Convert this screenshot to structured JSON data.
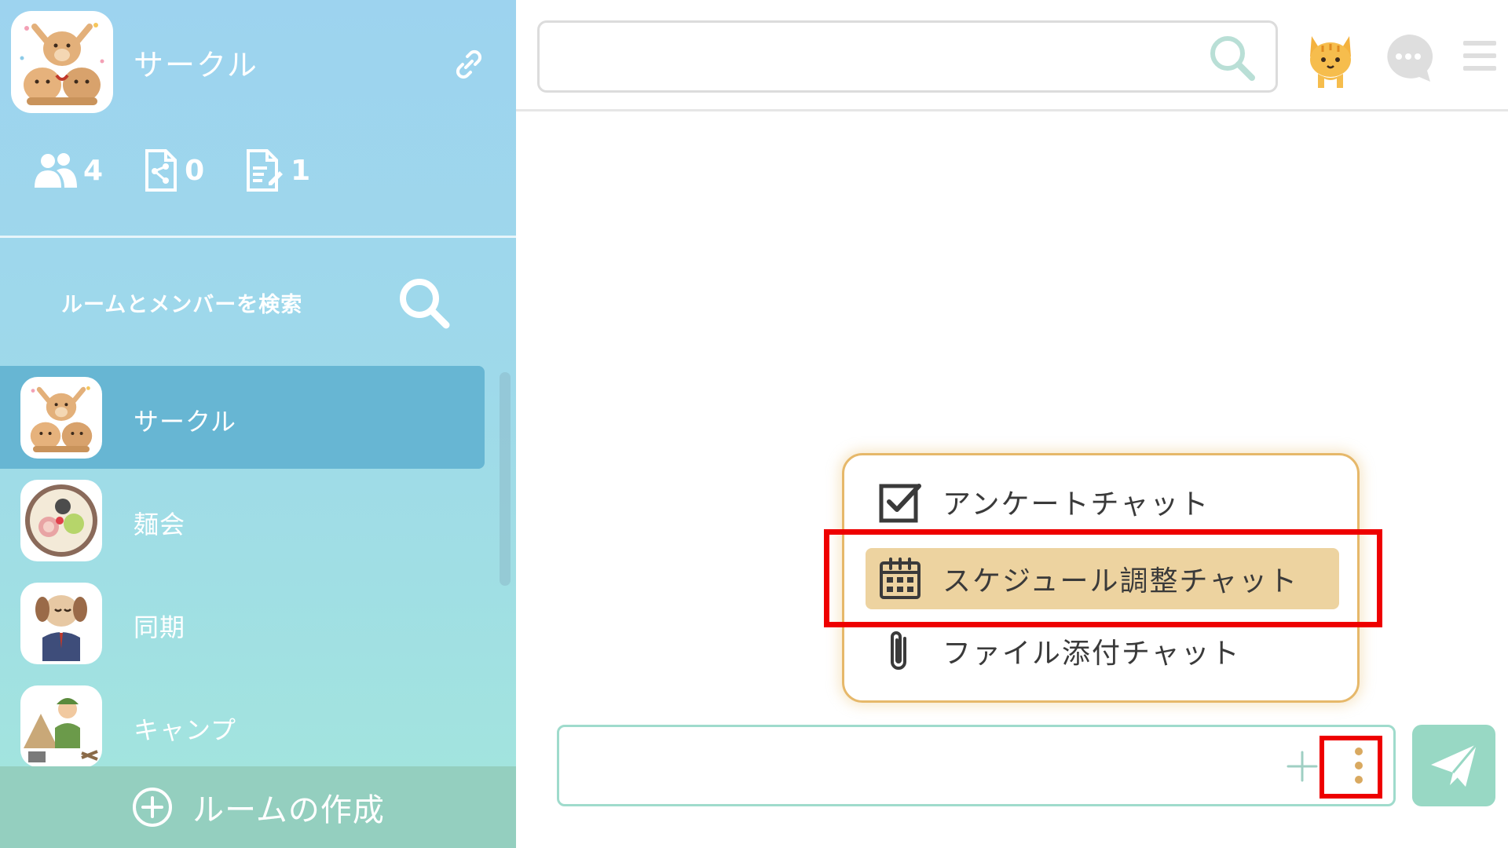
{
  "sidebar": {
    "group": {
      "title": "サークル",
      "avatar": "dogs-cheering-avatar",
      "link_icon": "link-icon"
    },
    "stats": [
      {
        "icon": "members-icon",
        "count": "4"
      },
      {
        "icon": "shared-file-icon",
        "count": "0"
      },
      {
        "icon": "note-edit-icon",
        "count": "1"
      }
    ],
    "search": {
      "label": "ルームとメンバーを検索",
      "icon": "search-icon"
    },
    "rooms": [
      {
        "name": "サークル",
        "avatar": "dogs-cheering-avatar",
        "active": true
      },
      {
        "name": "麺会",
        "avatar": "ramen-bowl-avatar",
        "active": false
      },
      {
        "name": "同期",
        "avatar": "dog-businessman-avatar",
        "active": false
      },
      {
        "name": "キャンプ",
        "avatar": "camper-avatar",
        "active": false
      }
    ],
    "create_room": {
      "label": "ルームの作成",
      "icon": "plus-circle-icon"
    }
  },
  "topbar": {
    "search_placeholder": "",
    "icons": [
      "search-icon",
      "cat-icon",
      "chat-bubble-icon",
      "hamburger-menu-icon"
    ]
  },
  "popup_menu": {
    "items": [
      {
        "label": "アンケートチャット",
        "icon": "checkbox-icon",
        "selected": false
      },
      {
        "label": "スケジュール調整チャット",
        "icon": "calendar-icon",
        "selected": true
      },
      {
        "label": "ファイル添付チャット",
        "icon": "paperclip-icon",
        "selected": false
      }
    ]
  },
  "composer": {
    "placeholder": "",
    "attach_icon": "plus-icon",
    "more_icon": "vertical-dots-icon",
    "send_icon": "paper-plane-icon"
  },
  "colors": {
    "sidebar_top": "#9dd3ef",
    "sidebar_bottom": "#a3e6dc",
    "active_room": "#67b6d3",
    "popup_border": "#e6b86a",
    "selected_item": "#edd3a0",
    "highlight_red": "#ee0000",
    "send_button": "#98d8c4"
  }
}
